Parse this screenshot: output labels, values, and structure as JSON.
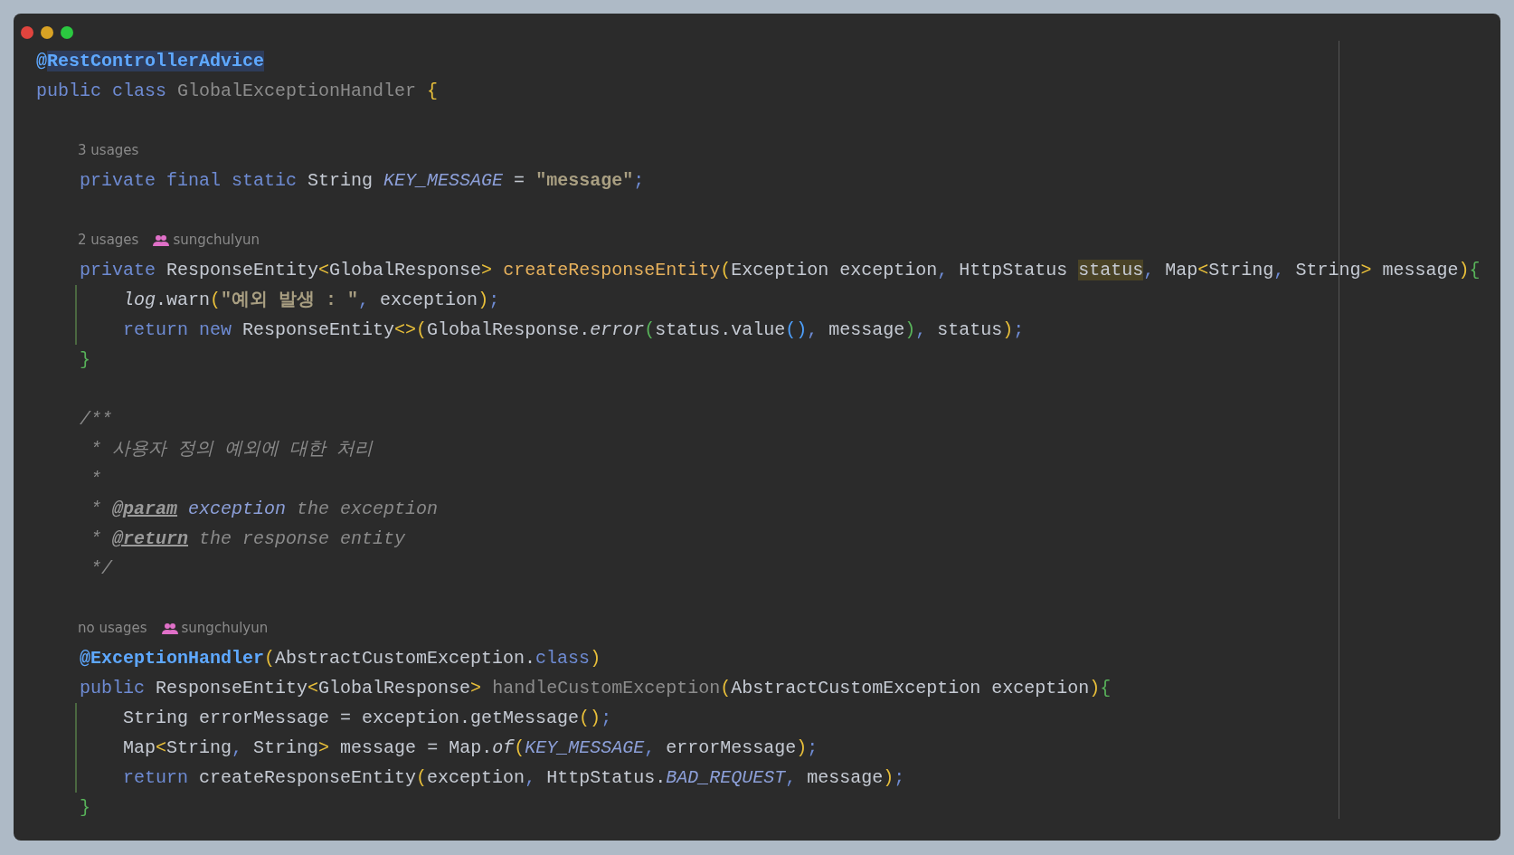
{
  "window": {
    "controls": [
      {
        "kind": "close"
      },
      {
        "kind": "minimize"
      },
      {
        "kind": "zoom"
      }
    ]
  },
  "lines": [
    {
      "kind": "code",
      "tokens": [
        {
          "text": "@",
          "kind": "ann"
        },
        {
          "text": "RestControllerAdvice",
          "kind": "ann",
          "selected": true
        }
      ]
    },
    {
      "kind": "code",
      "tokens": [
        {
          "text": "public class ",
          "kind": "kw"
        },
        {
          "text": "GlobalExceptionHandler ",
          "kind": "dim"
        },
        {
          "text": "{",
          "kind": "y"
        }
      ]
    },
    {
      "kind": "blank"
    },
    {
      "kind": "hint",
      "usages": "3 usages"
    },
    {
      "kind": "code",
      "tokens": [
        {
          "text": "    private final static ",
          "kind": "kw"
        },
        {
          "text": "String ",
          "kind": "pl"
        },
        {
          "text": "KEY_MESSAGE",
          "kind": "cst"
        },
        {
          "text": " = ",
          "kind": "pl"
        },
        {
          "text": "\"message\"",
          "kind": "str"
        },
        {
          "text": ";",
          "kind": "p"
        }
      ]
    },
    {
      "kind": "blank"
    },
    {
      "kind": "hint",
      "usages": "2 usages",
      "author": "sungchulyun"
    },
    {
      "kind": "code",
      "tokens": [
        {
          "text": "    private ",
          "kind": "kw"
        },
        {
          "text": "ResponseEntity",
          "kind": "pl"
        },
        {
          "text": "<",
          "kind": "y"
        },
        {
          "text": "GlobalResponse",
          "kind": "pl"
        },
        {
          "text": "> ",
          "kind": "y"
        },
        {
          "text": "createResponseEntity",
          "kind": "fn"
        },
        {
          "text": "(",
          "kind": "y"
        },
        {
          "text": "Exception exception",
          "kind": "pl"
        },
        {
          "text": ", ",
          "kind": "p"
        },
        {
          "text": "HttpStatus ",
          "kind": "pl"
        },
        {
          "text": "status",
          "kind": "pl",
          "highlighted": true
        },
        {
          "text": ", ",
          "kind": "p"
        },
        {
          "text": "Map",
          "kind": "pl"
        },
        {
          "text": "<",
          "kind": "y"
        },
        {
          "text": "String",
          "kind": "pl"
        },
        {
          "text": ", ",
          "kind": "p"
        },
        {
          "text": "String",
          "kind": "pl"
        },
        {
          "text": "> ",
          "kind": "y"
        },
        {
          "text": "message",
          "kind": "pl"
        },
        {
          "text": ")",
          "kind": "y"
        },
        {
          "text": "{",
          "kind": "g"
        }
      ]
    },
    {
      "kind": "code",
      "guide": true,
      "tokens": [
        {
          "text": "        log",
          "kind": "it"
        },
        {
          "text": ".warn",
          "kind": "pl"
        },
        {
          "text": "(",
          "kind": "y"
        },
        {
          "text": "\"예외 발생 : \"",
          "kind": "str"
        },
        {
          "text": ", ",
          "kind": "p"
        },
        {
          "text": "exception",
          "kind": "pl"
        },
        {
          "text": ")",
          "kind": "y"
        },
        {
          "text": ";",
          "kind": "p"
        }
      ]
    },
    {
      "kind": "code",
      "guide": true,
      "tokens": [
        {
          "text": "        return new ",
          "kind": "kw"
        },
        {
          "text": "ResponseEntity",
          "kind": "pl"
        },
        {
          "text": "<>",
          "kind": "y"
        },
        {
          "text": "(",
          "kind": "y"
        },
        {
          "text": "GlobalResponse.",
          "kind": "pl"
        },
        {
          "text": "error",
          "kind": "it"
        },
        {
          "text": "(",
          "kind": "g"
        },
        {
          "text": "status.value",
          "kind": "pl"
        },
        {
          "text": "()",
          "kind": "b"
        },
        {
          "text": ", ",
          "kind": "p"
        },
        {
          "text": "message",
          "kind": "pl"
        },
        {
          "text": ")",
          "kind": "g"
        },
        {
          "text": ", ",
          "kind": "p"
        },
        {
          "text": "status",
          "kind": "pl"
        },
        {
          "text": ")",
          "kind": "y"
        },
        {
          "text": ";",
          "kind": "p"
        }
      ]
    },
    {
      "kind": "code",
      "tokens": [
        {
          "text": "    }",
          "kind": "g"
        }
      ]
    },
    {
      "kind": "blank"
    },
    {
      "kind": "code",
      "tokens": [
        {
          "text": "    /**",
          "kind": "cm"
        }
      ]
    },
    {
      "kind": "code",
      "tokens": [
        {
          "text": "     * 사용자 정의 예외에 대한 처리",
          "kind": "cm"
        }
      ]
    },
    {
      "kind": "code",
      "tokens": [
        {
          "text": "     *",
          "kind": "cm"
        }
      ]
    },
    {
      "kind": "code",
      "tokens": [
        {
          "text": "     * ",
          "kind": "cm"
        },
        {
          "text": "@param",
          "kind": "tag"
        },
        {
          "text": " exception",
          "kind": "dp"
        },
        {
          "text": " the exception",
          "kind": "cm"
        }
      ]
    },
    {
      "kind": "code",
      "tokens": [
        {
          "text": "     * ",
          "kind": "cm"
        },
        {
          "text": "@return",
          "kind": "tag"
        },
        {
          "text": " the response entity",
          "kind": "cm"
        }
      ]
    },
    {
      "kind": "code",
      "tokens": [
        {
          "text": "     */",
          "kind": "cm"
        }
      ]
    },
    {
      "kind": "blank"
    },
    {
      "kind": "hint",
      "usages": "no usages",
      "author": "sungchulyun"
    },
    {
      "kind": "code",
      "tokens": [
        {
          "text": "    @ExceptionHandler",
          "kind": "ann"
        },
        {
          "text": "(",
          "kind": "y"
        },
        {
          "text": "AbstractCustomException.",
          "kind": "pl"
        },
        {
          "text": "class",
          "kind": "kw"
        },
        {
          "text": ")",
          "kind": "y"
        }
      ]
    },
    {
      "kind": "code",
      "tokens": [
        {
          "text": "    public ",
          "kind": "kw"
        },
        {
          "text": "ResponseEntity",
          "kind": "pl"
        },
        {
          "text": "<",
          "kind": "y"
        },
        {
          "text": "GlobalResponse",
          "kind": "pl"
        },
        {
          "text": "> ",
          "kind": "y"
        },
        {
          "text": "handleCustomException",
          "kind": "dim"
        },
        {
          "text": "(",
          "kind": "y"
        },
        {
          "text": "AbstractCustomException exception",
          "kind": "pl"
        },
        {
          "text": ")",
          "kind": "y"
        },
        {
          "text": "{",
          "kind": "g"
        }
      ]
    },
    {
      "kind": "code",
      "guide": true,
      "tokens": [
        {
          "text": "        String errorMessage = exception.getMessage",
          "kind": "pl"
        },
        {
          "text": "()",
          "kind": "y"
        },
        {
          "text": ";",
          "kind": "p"
        }
      ]
    },
    {
      "kind": "code",
      "guide": true,
      "tokens": [
        {
          "text": "        Map",
          "kind": "pl"
        },
        {
          "text": "<",
          "kind": "y"
        },
        {
          "text": "String",
          "kind": "pl"
        },
        {
          "text": ", ",
          "kind": "p"
        },
        {
          "text": "String",
          "kind": "pl"
        },
        {
          "text": "> ",
          "kind": "y"
        },
        {
          "text": "message = Map.",
          "kind": "pl"
        },
        {
          "text": "of",
          "kind": "it"
        },
        {
          "text": "(",
          "kind": "y"
        },
        {
          "text": "KEY_MESSAGE",
          "kind": "cst"
        },
        {
          "text": ", ",
          "kind": "p"
        },
        {
          "text": "errorMessage",
          "kind": "pl"
        },
        {
          "text": ")",
          "kind": "y"
        },
        {
          "text": ";",
          "kind": "p"
        }
      ]
    },
    {
      "kind": "code",
      "guide": true,
      "tokens": [
        {
          "text": "        return ",
          "kind": "kw"
        },
        {
          "text": "createResponseEntity",
          "kind": "pl"
        },
        {
          "text": "(",
          "kind": "y"
        },
        {
          "text": "exception",
          "kind": "pl"
        },
        {
          "text": ", ",
          "kind": "p"
        },
        {
          "text": "HttpStatus.",
          "kind": "pl"
        },
        {
          "text": "BAD_REQUEST",
          "kind": "cst"
        },
        {
          "text": ", ",
          "kind": "p"
        },
        {
          "text": "message",
          "kind": "pl"
        },
        {
          "text": ")",
          "kind": "y"
        },
        {
          "text": ";",
          "kind": "p"
        }
      ]
    },
    {
      "kind": "code",
      "tokens": [
        {
          "text": "    }",
          "kind": "g"
        }
      ]
    }
  ]
}
